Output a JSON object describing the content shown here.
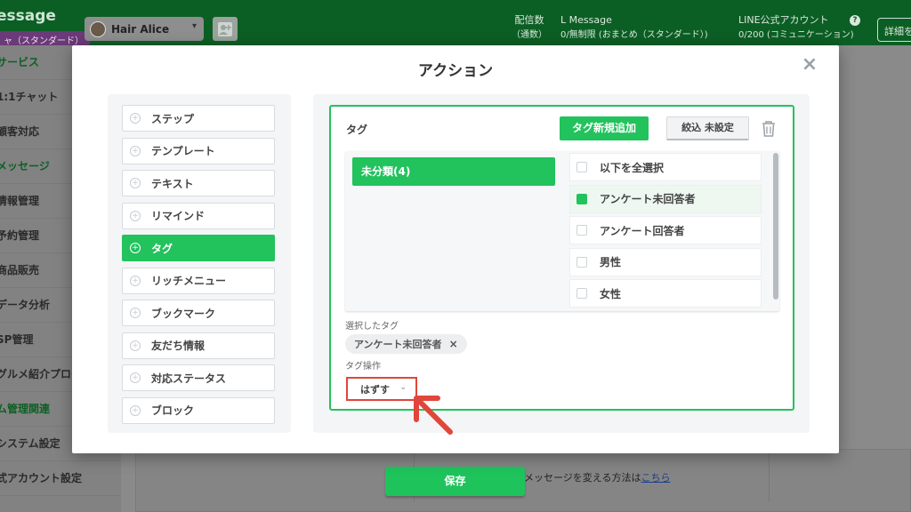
{
  "app": {
    "brand": "essage",
    "plan_badge": "ャ（スタンダード）",
    "account_name": "Hair Alice",
    "stats": [
      {
        "title": "配信数",
        "sub": "（通数）"
      },
      {
        "title": "L Message",
        "sub": "0/無制限 (おまとめ（スタンダード）)"
      },
      {
        "title": "LINE公式アカウント",
        "sub": "0/200 (コミュニケーション)"
      }
    ],
    "detail_button": "詳細を"
  },
  "sidebar": {
    "items": [
      {
        "label": "サービス",
        "section": true
      },
      {
        "label": "1:1チャット",
        "section": false
      },
      {
        "label": "顧客対応",
        "section": false
      },
      {
        "label": "メッセージ",
        "section": true
      },
      {
        "label": "情報管理",
        "section": false
      },
      {
        "label": "予約管理",
        "section": false
      },
      {
        "label": "商品販売",
        "section": false
      },
      {
        "label": "データ分析",
        "section": false
      },
      {
        "label": "SP管理",
        "section": false
      },
      {
        "label": "グルメ紹介プログ",
        "section": false
      },
      {
        "label": "ム管理関連",
        "section": true
      },
      {
        "label": "システム設定",
        "section": false
      },
      {
        "label": "式アカウント設定",
        "section": false
      }
    ]
  },
  "background": {
    "hint_text": "るメッセージを変える方法は",
    "hint_link": "こちら",
    "save_button": "保存"
  },
  "modal": {
    "title": "アクション",
    "close_glyph": "×",
    "actions": [
      {
        "label": "ステップ",
        "active": false
      },
      {
        "label": "テンプレート",
        "active": false
      },
      {
        "label": "テキスト",
        "active": false
      },
      {
        "label": "リマインド",
        "active": false
      },
      {
        "label": "タグ",
        "active": true
      },
      {
        "label": "リッチメニュー",
        "active": false
      },
      {
        "label": "ブックマーク",
        "active": false
      },
      {
        "label": "友だち情報",
        "active": false
      },
      {
        "label": "対応ステータス",
        "active": false
      },
      {
        "label": "ブロック",
        "active": false
      }
    ],
    "tag_section": {
      "label": "タグ",
      "new_tag_button": "タグ新規追加",
      "filter_button": "絞込 未設定",
      "folder": "未分類(4)",
      "tags": [
        {
          "label": "以下を全選択",
          "checked": false
        },
        {
          "label": "アンケート未回答者",
          "checked": true
        },
        {
          "label": "アンケート回答者",
          "checked": false
        },
        {
          "label": "男性",
          "checked": false
        },
        {
          "label": "女性",
          "checked": false
        }
      ],
      "selected_label": "選択したタグ",
      "selected_chip": "アンケート未回答者",
      "chip_remove": "×",
      "operation_label": "タグ操作",
      "operation_value": "はずす"
    }
  },
  "colors": {
    "accent_green": "#22c25d",
    "highlight_red": "#e0463b",
    "header_green_dimmed": "#0c5f24"
  }
}
